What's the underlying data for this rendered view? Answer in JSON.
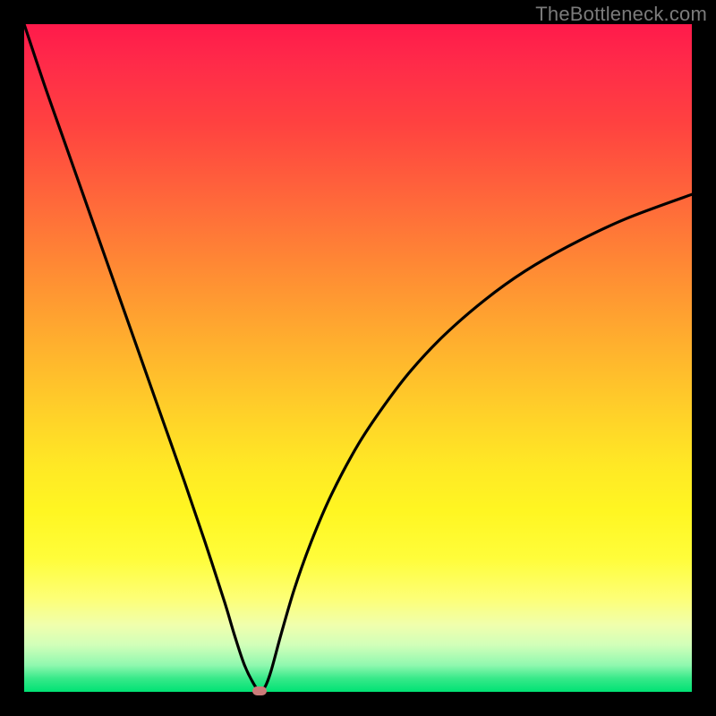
{
  "watermark": "TheBottleneck.com",
  "colors": {
    "frame": "#000000",
    "curve": "#000000",
    "marker": "#cb7b79"
  },
  "chart_data": {
    "type": "line",
    "title": "",
    "xlabel": "",
    "ylabel": "",
    "xlim": [
      0,
      100
    ],
    "ylim": [
      0,
      100
    ],
    "grid": false,
    "notes": "Vertical gradient background from red (top) through orange/yellow to green (bottom) indicating bottleneck severity; single black V-shaped curve; small marker at the minimum.",
    "series": [
      {
        "name": "bottleneck-curve",
        "x": [
          0,
          3,
          6,
          9,
          12,
          15,
          18,
          21,
          24,
          27,
          30,
          31.5,
          33,
          34.5,
          35.3,
          36.1,
          37,
          38.5,
          40.5,
          43,
          46,
          50,
          54,
          58,
          63,
          69,
          75,
          82,
          90,
          100
        ],
        "y": [
          100,
          91,
          82.5,
          74,
          65.5,
          57,
          48.5,
          40,
          31.5,
          22.7,
          13.5,
          8.5,
          4,
          1,
          0.2,
          0.8,
          3.2,
          8.7,
          15.5,
          22.5,
          29.5,
          37,
          43,
          48.2,
          53.5,
          58.7,
          63,
          67,
          70.8,
          74.5
        ]
      }
    ],
    "marker": {
      "x": 35.3,
      "y": 0.2
    }
  }
}
